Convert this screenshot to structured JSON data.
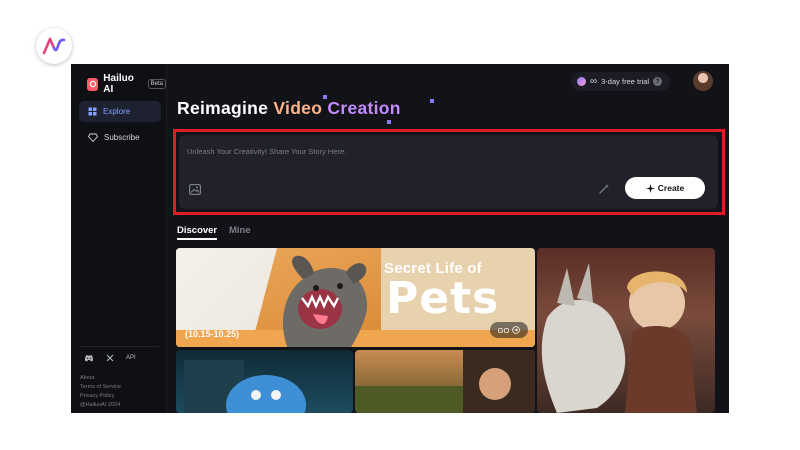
{
  "brand": {
    "name": "Hailuo AI",
    "badge": "Beta"
  },
  "sidebar": {
    "items": [
      {
        "label": "Explore",
        "active": true
      },
      {
        "label": "Subscribe",
        "active": false
      }
    ],
    "socials": {
      "api_label": "API"
    },
    "footer_links": [
      "About",
      "Terms of Service",
      "Privacy Policy",
      "@HailuoAI 2024"
    ]
  },
  "header": {
    "infinity": "∞",
    "trial_label": "3-day free trial",
    "help": "?"
  },
  "hero": {
    "word1": "Reimagine",
    "word2": "Video",
    "word3": "Creation"
  },
  "prompt": {
    "placeholder": "Unleash Your Creativity! Share Your Story Here.",
    "create_label": "Create"
  },
  "tabs": [
    {
      "label": "Discover",
      "active": true
    },
    {
      "label": "Mine",
      "active": false
    }
  ],
  "featured": {
    "subtitle": "Secret Life of",
    "title": "Pets",
    "date": "(10.15-10.25)",
    "go_label": "GO"
  },
  "colors": {
    "accent": "#7fa2ff",
    "highlight": "#e21b24",
    "title_video": "#ffb38a",
    "title_creation": "#c38bff"
  }
}
